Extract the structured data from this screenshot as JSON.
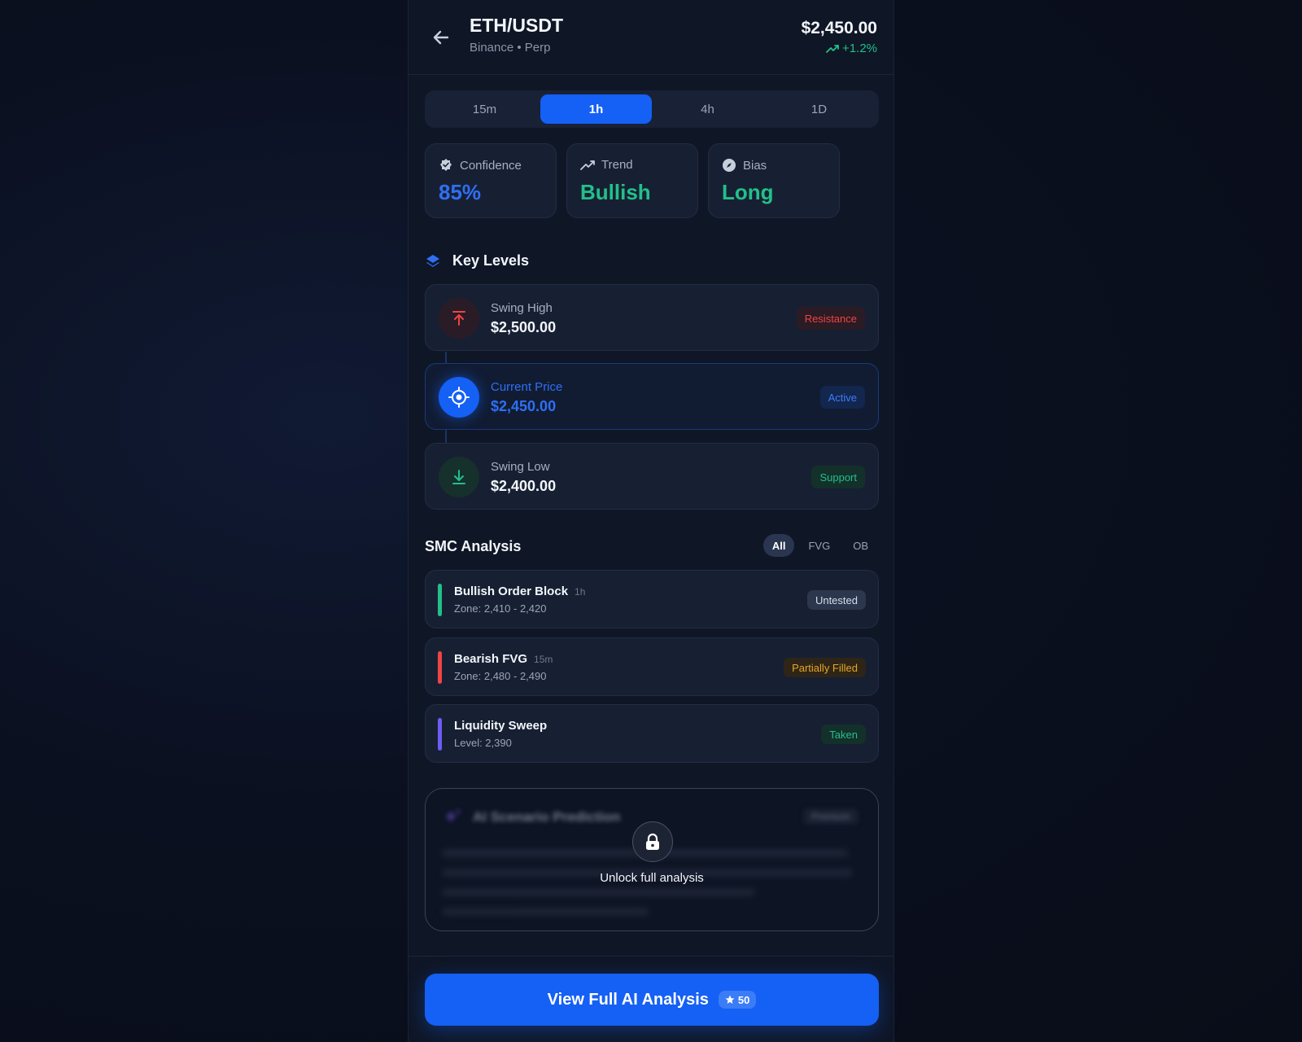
{
  "header": {
    "pair": "ETH/USDT",
    "subtitle": "Binance • Perp",
    "price": "$2,450.00",
    "change": "+1.2%"
  },
  "timeframes": [
    {
      "label": "15m",
      "active": false
    },
    {
      "label": "1h",
      "active": true
    },
    {
      "label": "4h",
      "active": false
    },
    {
      "label": "1D",
      "active": false
    }
  ],
  "stats": {
    "confidence": {
      "label": "Confidence",
      "value": "85%",
      "color": "#2f6ff5"
    },
    "trend": {
      "label": "Trend",
      "value": "Bullish",
      "color": "#22c08a"
    },
    "bias": {
      "label": "Bias",
      "value": "Long",
      "color": "#22c08a"
    }
  },
  "key_levels": {
    "title": "Key Levels",
    "items": [
      {
        "name": "Swing High",
        "value": "$2,500.00",
        "tag": "Resistance"
      },
      {
        "name": "Current Price",
        "value": "$2,450.00",
        "tag": "Active"
      },
      {
        "name": "Swing Low",
        "value": "$2,400.00",
        "tag": "Support"
      }
    ]
  },
  "smc": {
    "title": "SMC Analysis",
    "filters": [
      "All",
      "FVG",
      "OB"
    ],
    "active_filter": "All",
    "items": [
      {
        "name": "Bullish Order Block",
        "timeframe": "1h",
        "detail": "Zone: 2,410 - 2,420",
        "status": "Untested",
        "color": "#22c08a"
      },
      {
        "name": "Bearish FVG",
        "timeframe": "15m",
        "detail": "Zone: 2,480 - 2,490",
        "status": "Partially Filled",
        "color": "#ef4444"
      },
      {
        "name": "Liquidity Sweep",
        "timeframe": "",
        "detail": "Level: 2,390",
        "status": "Taken",
        "color": "#6d5df5"
      }
    ]
  },
  "locked": {
    "title": "AI Scenario Prediction",
    "badge": "Premium",
    "message": "Unlock full analysis"
  },
  "cta": {
    "label": "View Full AI Analysis",
    "cost": "50"
  },
  "colors": {
    "accent": "#1560f5",
    "bullish": "#22c08a",
    "bearish": "#ef4444",
    "warning": "#e5a623"
  }
}
